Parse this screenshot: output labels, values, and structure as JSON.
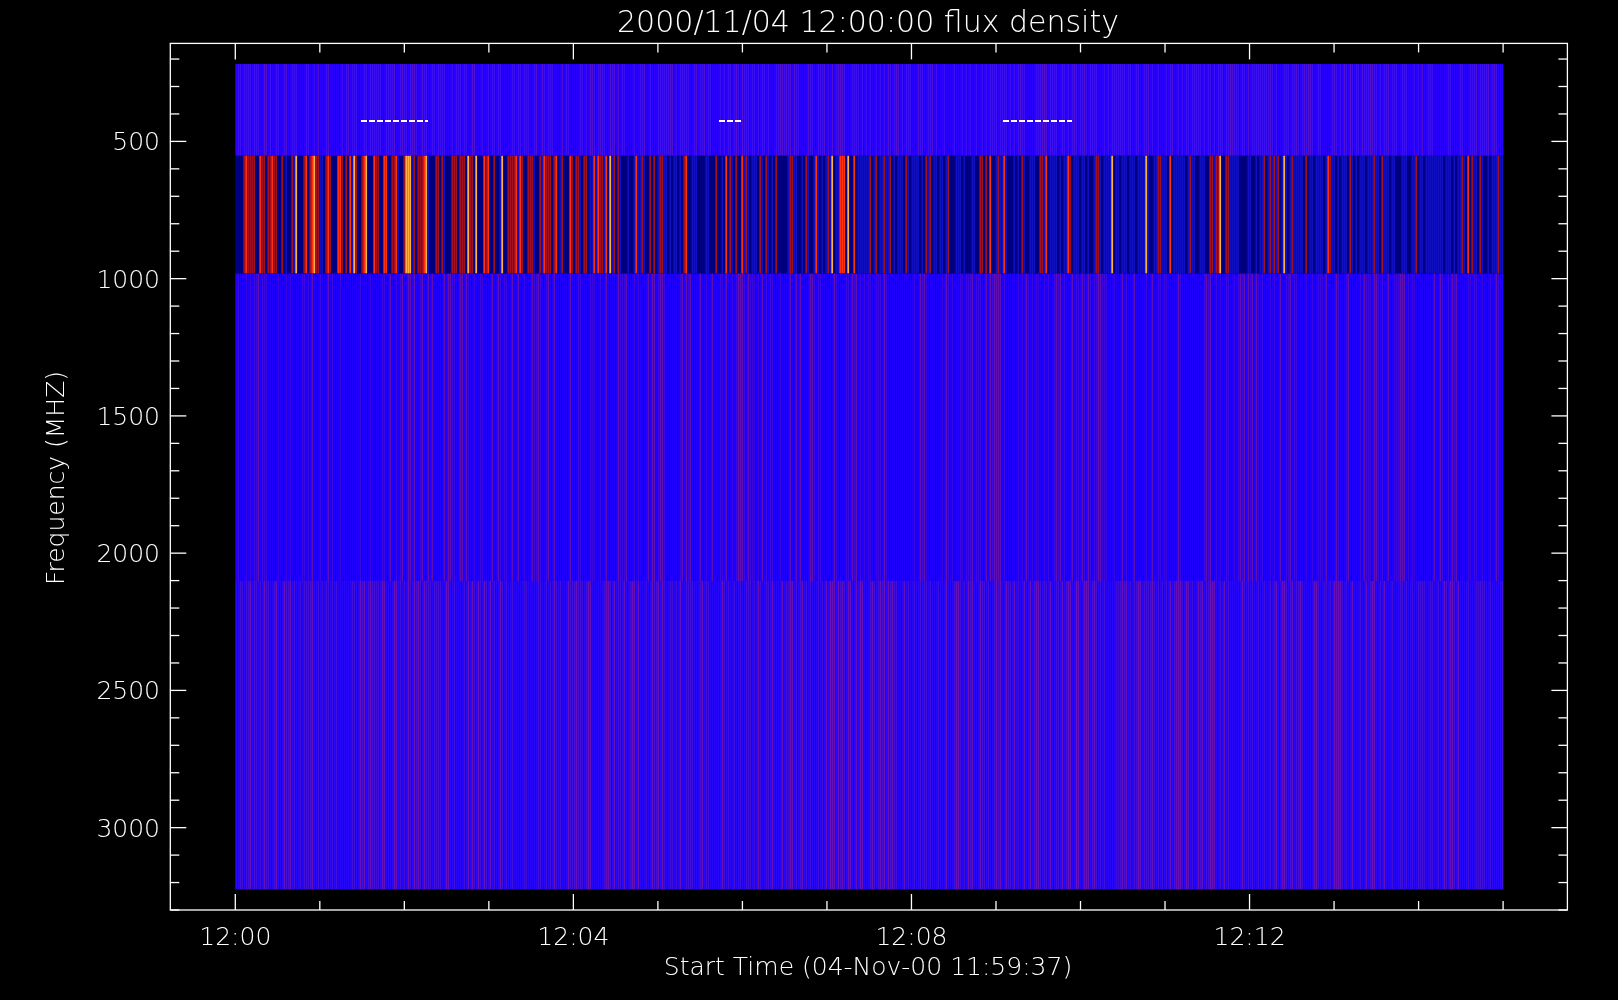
{
  "plot": {
    "title": "2000/11/04 12:00:00 flux density",
    "ylabel": "Frequency (MHZ)",
    "xlabel": "Start Time (04-Nov-00 11:59:37)",
    "yticks": [
      "500",
      "1000",
      "1500",
      "2000",
      "2500",
      "3000"
    ],
    "xticks": [
      "12:00",
      "12:04",
      "12:08",
      "12:12"
    ]
  }
}
